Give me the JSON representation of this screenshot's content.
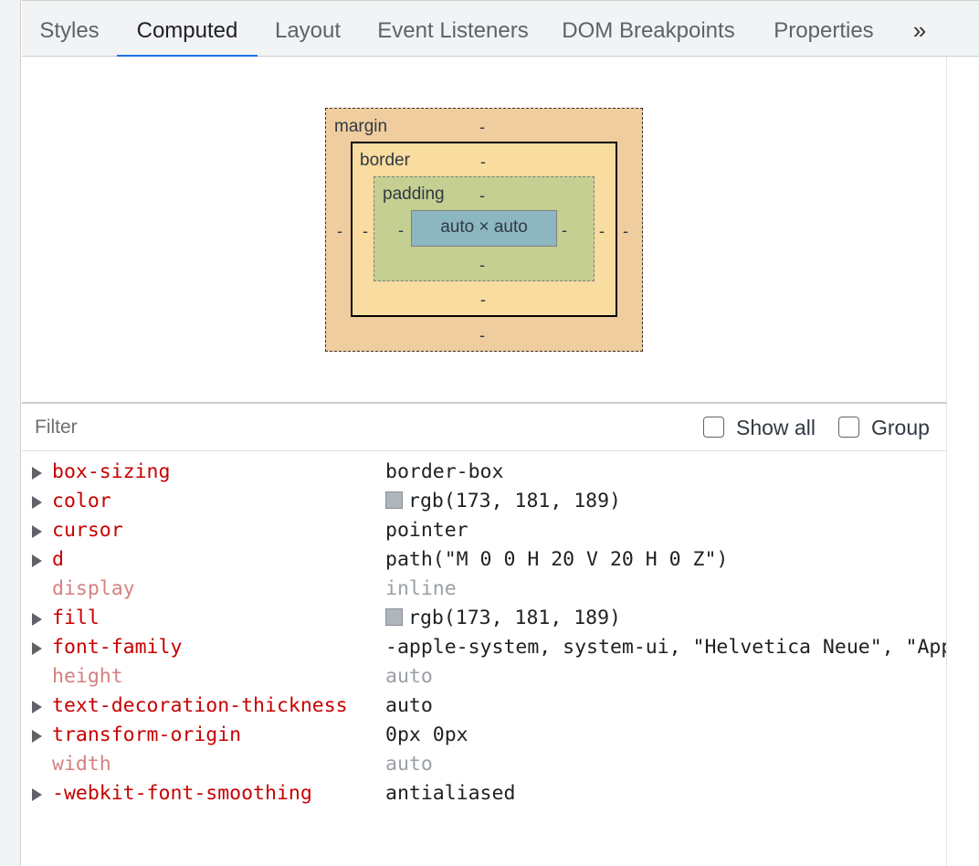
{
  "tabs": [
    {
      "label": "Styles",
      "active": false
    },
    {
      "label": "Computed",
      "active": true
    },
    {
      "label": "Layout",
      "active": false
    },
    {
      "label": "Event Listeners",
      "active": false
    },
    {
      "label": "DOM Breakpoints",
      "active": false
    },
    {
      "label": "Properties",
      "active": false
    }
  ],
  "tab_more_symbol": "»",
  "box_model": {
    "margin_label": "margin",
    "border_label": "border",
    "padding_label": "padding",
    "content": "auto × auto",
    "margin": {
      "top": "-",
      "right": "-",
      "bottom": "-",
      "left": "-"
    },
    "border": {
      "top": "-",
      "right": "-",
      "bottom": "-",
      "left": "-"
    },
    "padding": {
      "top": "-",
      "right": "-",
      "bottom": "-",
      "left": "-"
    },
    "colors": {
      "margin": "#f0cd9f",
      "border": "#f8dca0",
      "padding": "#c4cf91",
      "content": "#8cb6c0"
    }
  },
  "filter": {
    "placeholder": "Filter",
    "value": ""
  },
  "checkboxes": {
    "show_all": {
      "label": "Show all",
      "checked": false
    },
    "group": {
      "label": "Group",
      "checked": false
    }
  },
  "properties": [
    {
      "name": "box-sizing",
      "value": "border-box",
      "expandable": true,
      "inherited": false
    },
    {
      "name": "color",
      "value": "rgb(173, 181, 189)",
      "expandable": true,
      "inherited": false,
      "swatch": "#adb5bd"
    },
    {
      "name": "cursor",
      "value": "pointer",
      "expandable": true,
      "inherited": false
    },
    {
      "name": "d",
      "value": "path(\"M 0 0 H 20 V 20 H 0 Z\")",
      "expandable": true,
      "inherited": false
    },
    {
      "name": "display",
      "value": "inline",
      "expandable": false,
      "inherited": true
    },
    {
      "name": "fill",
      "value": "rgb(173, 181, 189)",
      "expandable": true,
      "inherited": false,
      "swatch": "#adb5bd"
    },
    {
      "name": "font-family",
      "value": "-apple-system, system-ui, \"Helvetica Neue\", \"Apple Color Emoji\"",
      "expandable": true,
      "inherited": false
    },
    {
      "name": "height",
      "value": "auto",
      "expandable": false,
      "inherited": true
    },
    {
      "name": "text-decoration-thickness",
      "value": "auto",
      "expandable": true,
      "inherited": false
    },
    {
      "name": "transform-origin",
      "value": "0px 0px",
      "expandable": true,
      "inherited": false
    },
    {
      "name": "width",
      "value": "auto",
      "expandable": false,
      "inherited": true
    },
    {
      "name": "-webkit-font-smoothing",
      "value": "antialiased",
      "expandable": true,
      "inherited": false
    }
  ]
}
